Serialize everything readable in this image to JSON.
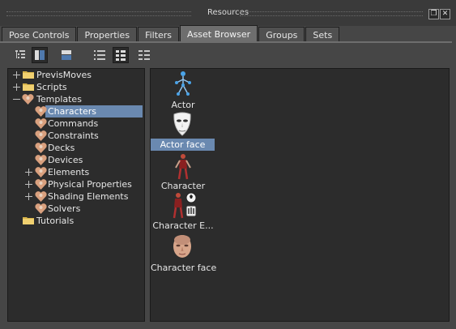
{
  "window": {
    "title": "Resources"
  },
  "tabs": [
    {
      "label": "Pose Controls"
    },
    {
      "label": "Properties"
    },
    {
      "label": "Filters"
    },
    {
      "label": "Asset Browser",
      "active": true
    },
    {
      "label": "Groups"
    },
    {
      "label": "Sets"
    }
  ],
  "tree": [
    {
      "label": "PrevisMoves",
      "icon": "folder-icon"
    },
    {
      "label": "Scripts",
      "icon": "folder-icon"
    },
    {
      "label": "Templates",
      "icon": "template-icon"
    },
    {
      "label": "Characters",
      "icon": "template-icon",
      "selected": true
    },
    {
      "label": "Commands",
      "icon": "template-icon"
    },
    {
      "label": "Constraints",
      "icon": "template-icon"
    },
    {
      "label": "Decks",
      "icon": "template-icon"
    },
    {
      "label": "Devices",
      "icon": "template-icon"
    },
    {
      "label": "Elements",
      "icon": "template-icon"
    },
    {
      "label": "Physical Properties",
      "icon": "template-icon"
    },
    {
      "label": "Shading Elements",
      "icon": "template-icon"
    },
    {
      "label": "Solvers",
      "icon": "template-icon"
    },
    {
      "label": "Tutorials",
      "icon": "folder-icon"
    }
  ],
  "assets": [
    {
      "label": "Actor",
      "icon": "actor-icon"
    },
    {
      "label": "Actor face",
      "icon": "actor-face-icon",
      "selected": true
    },
    {
      "label": "Character",
      "icon": "character-icon"
    },
    {
      "label": "Character E...",
      "icon": "character-extension-icon"
    },
    {
      "label": "Character face",
      "icon": "character-face-icon"
    }
  ],
  "colors": {
    "selection": "#6a89b0",
    "panel": "#2c2c2c",
    "background": "#464646"
  }
}
